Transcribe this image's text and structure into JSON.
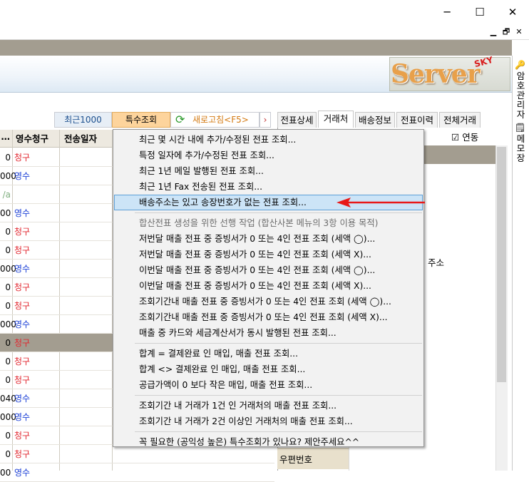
{
  "window": {
    "minimize": "─",
    "maximize": "☐",
    "close": "✕"
  },
  "mdi": {
    "minimize": "▁",
    "restore": "🗗",
    "close": "✕"
  },
  "logo": {
    "text": "Server",
    "badge": "SKY"
  },
  "toolbar": {
    "recent": "최근1000",
    "special": "특수조회",
    "refresh": "새로고침<F5>",
    "next": "›"
  },
  "right_tabs": [
    "전표상세",
    "거래처",
    "배송정보",
    "전표이력",
    "전체거래"
  ],
  "link_checkbox": {
    "label": "연동",
    "checked": true
  },
  "grid": {
    "headers": [
      "…",
      "영수청구",
      "전송일자"
    ],
    "rows": [
      {
        "amount": "0",
        "type": "청구",
        "color": "red"
      },
      {
        "amount": "000",
        "type": "영수",
        "color": "blue"
      },
      {
        "amount": "/a",
        "type": "",
        "color": "na"
      },
      {
        "amount": "00",
        "type": "영수",
        "color": "blue"
      },
      {
        "amount": "0",
        "type": "청구",
        "color": "red"
      },
      {
        "amount": "0",
        "type": "청구",
        "color": "red"
      },
      {
        "amount": "000",
        "type": "영수",
        "color": "blue"
      },
      {
        "amount": "0",
        "type": "청구",
        "color": "red"
      },
      {
        "amount": "0",
        "type": "청구",
        "color": "red"
      },
      {
        "amount": "000",
        "type": "영수",
        "color": "blue"
      },
      {
        "amount": "0",
        "type": "청구",
        "color": "red",
        "selected": true
      },
      {
        "amount": "0",
        "type": "청구",
        "color": "red"
      },
      {
        "amount": "0",
        "type": "청구",
        "color": "red"
      },
      {
        "amount": "040",
        "type": "영수",
        "color": "blue"
      },
      {
        "amount": "000",
        "type": "영수",
        "color": "blue"
      },
      {
        "amount": "0",
        "type": "청구",
        "color": "red"
      },
      {
        "amount": "0",
        "type": "청구",
        "color": "red"
      },
      {
        "amount": "00",
        "type": "영수",
        "color": "blue"
      }
    ]
  },
  "right_panel": {
    "address_label": "주소",
    "zip_label": "우편번호"
  },
  "side_tabs": [
    "암호관리자",
    "메모장"
  ],
  "menu": {
    "group1": [
      "최근 몇 시간 내에 추가/수정된 전표 조회...",
      "특정 일자에 추가/수정된 전표 조회...",
      "최근 1년 메일 발행된 전표 조회...",
      "최근 1년 Fax 전송된 전표 조회...",
      "배송주소는 있고 송장번호가 없는 전표 조회..."
    ],
    "group2_header": "합산전표 생성을 위한 선행 작업 (합산사본 메뉴의 3항 이용 목적)",
    "group2": [
      "저번달 매출 전표 중 증빙서가 0 또는 4인 전표 조회 (세액 ◯)...",
      "저번달 매출 전표 중 증빙서가 0 또는 4인 전표 조회 (세액 X)...",
      "이번달 매출 전표 중 증빙서가 0 또는 4인 전표 조회 (세액 ◯)...",
      "이번달 매출 전표 중 증빙서가 0 또는 4인 전표 조회 (세액 X)...",
      "조회기간내 매출 전표 중 증빙서가 0 또는 4인 전표 조회 (세액 ◯)...",
      "조회기간내 매출 전표 중 증빙서가 0 또는 4인 전표 조회 (세액 X)...",
      "매출 중 카드와 세금계산서가 동시 발행된 전표 조회..."
    ],
    "group3": [
      "합계 = 결제완료 인 매입, 매출 전표 조회...",
      "합계 <> 결제완료 인 매입, 매출 전표 조회...",
      "공급가액이 0 보다 작은 매입, 매출 전표 조회..."
    ],
    "group4": [
      "조회기간 내 거래가 1건 인 거래처의 매출 전표 조회...",
      "조회기간 내 거래가 2건 이상인 거래처의 매출 전표 조회..."
    ],
    "group5": [
      "꼭 필요한 (공익성 높은) 특수조회가 있나요? 제안주세요^^"
    ]
  },
  "colors": {
    "accent_red": "#e2262e",
    "accent_blue": "#1a3ed6",
    "highlight": "#cce4f7",
    "band": "#a39d90"
  }
}
